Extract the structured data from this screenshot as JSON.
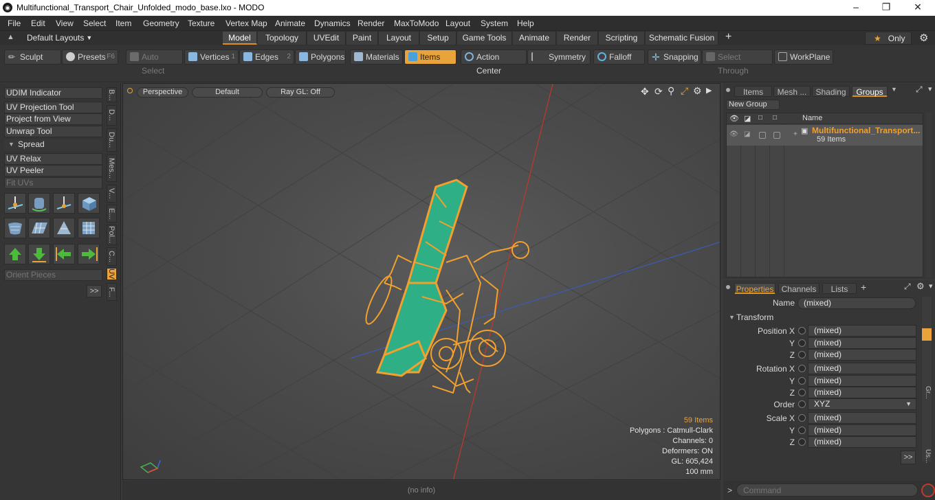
{
  "window": {
    "title": "Multifunctional_Transport_Chair_Unfolded_modo_base.lxo - MODO"
  },
  "menu": [
    "File",
    "Edit",
    "View",
    "Select",
    "Item",
    "Geometry",
    "Texture",
    "Vertex Map",
    "Animate",
    "Dynamics",
    "Render",
    "MaxToModo",
    "Layout",
    "System",
    "Help"
  ],
  "layouts": {
    "label": "Default Layouts",
    "tabs": [
      "Model",
      "Topology",
      "UVEdit",
      "Paint",
      "Layout",
      "Setup",
      "Game Tools",
      "Animate",
      "Render",
      "Scripting",
      "Schematic Fusion"
    ],
    "add": "+",
    "only": "Only"
  },
  "toolbar": {
    "sculpt": "Sculpt",
    "presets": "Presets",
    "presets_key": "F6",
    "auto_select": "Auto Select",
    "vertices": "Vertices",
    "vertices_key": "1",
    "edges": "Edges",
    "edges_key": "2",
    "polygons": "Polygons",
    "materials": "Materials",
    "items": "Items",
    "action_center": "Action Center",
    "symmetry": "Symmetry",
    "falloff": "Falloff",
    "snapping": "Snapping",
    "select_through": "Select Through",
    "workplane": "WorkPlane"
  },
  "left_panel": {
    "buttons": [
      "UDIM Indicator",
      "UV Projection Tool",
      "Project from View",
      "Unwrap Tool"
    ],
    "spread": "Spread",
    "buttons2": [
      "UV Relax",
      "UV Peeler"
    ],
    "fit_uvs": "Fit UVs",
    "orient_pieces": "Orient Pieces",
    "more": ">>",
    "vtabs": [
      "B...",
      "D...",
      "Du...",
      "Mes...",
      "V...",
      "E...",
      "Pol...",
      "C...",
      "UV",
      "F..."
    ]
  },
  "viewport": {
    "perspective": "Perspective",
    "default": "Default",
    "raygl": "Ray GL: Off",
    "stats": {
      "items": "59 Items",
      "polygons": "Polygons : Catmull-Clark",
      "channels": "Channels: 0",
      "deformers": "Deformers: ON",
      "gl": "GL: 605,424",
      "scale": "100 mm"
    }
  },
  "status": "(no info)",
  "groups_panel": {
    "tabs": [
      "Items",
      "Mesh ...",
      "Shading",
      "Groups"
    ],
    "new_group": "New Group",
    "col_name": "Name",
    "group_name": "Multifunctional_Transport...",
    "group_count": "59 Items"
  },
  "properties": {
    "tabs": [
      "Properties",
      "Channels",
      "Lists"
    ],
    "add": "+",
    "name_label": "Name",
    "name_value": "(mixed)",
    "transform": "Transform",
    "position_x": "Position X",
    "rotation_x": "Rotation X",
    "scale_x": "Scale X",
    "y": "Y",
    "z": "Z",
    "order_label": "Order",
    "order_value": "XYZ",
    "mixed": "(mixed)",
    "more": ">>",
    "side_tabs": [
      "Gr...",
      "Us..."
    ]
  },
  "command": {
    "placeholder": "Command"
  },
  "colors": {
    "accent": "#e9a33b",
    "wire": "#f2a12e",
    "seat": "#2eaf86"
  }
}
